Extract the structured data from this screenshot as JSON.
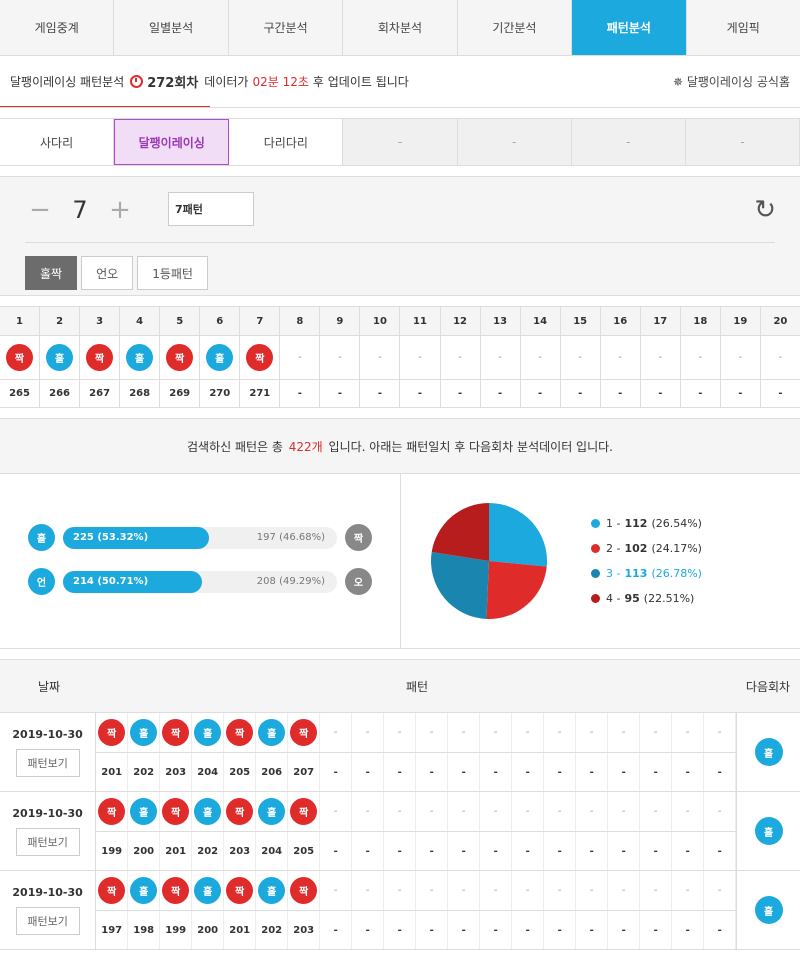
{
  "top_tabs": [
    "게임중계",
    "일별분석",
    "구간분석",
    "회차분석",
    "기간분석",
    "패턴분석",
    "게임픽"
  ],
  "info": {
    "title": "달팽이레이싱 패턴분석",
    "round": "272회차",
    "text1": "데이터가",
    "time": "02분 12초",
    "text2": "후 업데이트 됩니다",
    "home": "달팽이레이싱 공식홈"
  },
  "game_tabs": [
    "사다리",
    "달팽이레이싱",
    "다리다리",
    "-",
    "-",
    "-",
    "-"
  ],
  "stepper": {
    "value": "7",
    "pattern": "7패턴"
  },
  "filter_buttons": [
    "홀짝",
    "언오",
    "1등패턴"
  ],
  "grid": {
    "headers": [
      "1",
      "2",
      "3",
      "4",
      "5",
      "6",
      "7",
      "8",
      "9",
      "10",
      "11",
      "12",
      "13",
      "14",
      "15",
      "16",
      "17",
      "18",
      "19",
      "20"
    ],
    "balls": [
      "짝",
      "홀",
      "짝",
      "홀",
      "짝",
      "홀",
      "짝",
      "-",
      "-",
      "-",
      "-",
      "-",
      "-",
      "-",
      "-",
      "-",
      "-",
      "-",
      "-",
      "-"
    ],
    "rounds": [
      "265",
      "266",
      "267",
      "268",
      "269",
      "270",
      "271",
      "-",
      "-",
      "-",
      "-",
      "-",
      "-",
      "-",
      "-",
      "-",
      "-",
      "-",
      "-",
      "-"
    ]
  },
  "summary": {
    "pre": "검색하신 패턴은 총",
    "count": "422개",
    "post": "입니다. 아래는 패턴일치 후 다음회차 분석데이터 입니다."
  },
  "bars": [
    {
      "left_icon": "홀",
      "left_text": "225 (53.32%)",
      "left_pct": 53.32,
      "right_text": "197 (46.68%)",
      "right_icon": "짝"
    },
    {
      "left_icon": "언",
      "left_text": "214 (50.71%)",
      "left_pct": 50.71,
      "right_text": "208 (49.29%)",
      "right_icon": "오"
    }
  ],
  "pie": {
    "legend": [
      {
        "label": "1",
        "value": "112",
        "pct": "(26.54%)",
        "color": "#1ca9de",
        "num": 112
      },
      {
        "label": "2",
        "value": "102",
        "pct": "(24.17%)",
        "color": "#e02b2b",
        "num": 102
      },
      {
        "label": "3",
        "value": "113",
        "pct": "(26.78%)",
        "color": "#1a86b0",
        "num": 113
      },
      {
        "label": "4",
        "value": "95",
        "pct": "(22.51%)",
        "color": "#b81d1d",
        "num": 95
      }
    ]
  },
  "table": {
    "headers": [
      "날짜",
      "패턴",
      "다음회차"
    ],
    "rows": [
      {
        "date": "2019-10-30",
        "view": "패턴보기",
        "balls": [
          "짝",
          "홀",
          "짝",
          "홀",
          "짝",
          "홀",
          "짝",
          "-",
          "-",
          "-",
          "-",
          "-",
          "-",
          "-",
          "-",
          "-",
          "-",
          "-",
          "-",
          "-"
        ],
        "rounds": [
          "201",
          "202",
          "203",
          "204",
          "205",
          "206",
          "207",
          "-",
          "-",
          "-",
          "-",
          "-",
          "-",
          "-",
          "-",
          "-",
          "-",
          "-",
          "-",
          "-"
        ],
        "next": "홀"
      },
      {
        "date": "2019-10-30",
        "view": "패턴보기",
        "balls": [
          "짝",
          "홀",
          "짝",
          "홀",
          "짝",
          "홀",
          "짝",
          "-",
          "-",
          "-",
          "-",
          "-",
          "-",
          "-",
          "-",
          "-",
          "-",
          "-",
          "-",
          "-"
        ],
        "rounds": [
          "199",
          "200",
          "201",
          "202",
          "203",
          "204",
          "205",
          "-",
          "-",
          "-",
          "-",
          "-",
          "-",
          "-",
          "-",
          "-",
          "-",
          "-",
          "-",
          "-"
        ],
        "next": "홀"
      },
      {
        "date": "2019-10-30",
        "view": "패턴보기",
        "balls": [
          "짝",
          "홀",
          "짝",
          "홀",
          "짝",
          "홀",
          "짝",
          "-",
          "-",
          "-",
          "-",
          "-",
          "-",
          "-",
          "-",
          "-",
          "-",
          "-",
          "-",
          "-"
        ],
        "rounds": [
          "197",
          "198",
          "199",
          "200",
          "201",
          "202",
          "203",
          "-",
          "-",
          "-",
          "-",
          "-",
          "-",
          "-",
          "-",
          "-",
          "-",
          "-",
          "-",
          "-"
        ],
        "next": "홀"
      }
    ]
  }
}
